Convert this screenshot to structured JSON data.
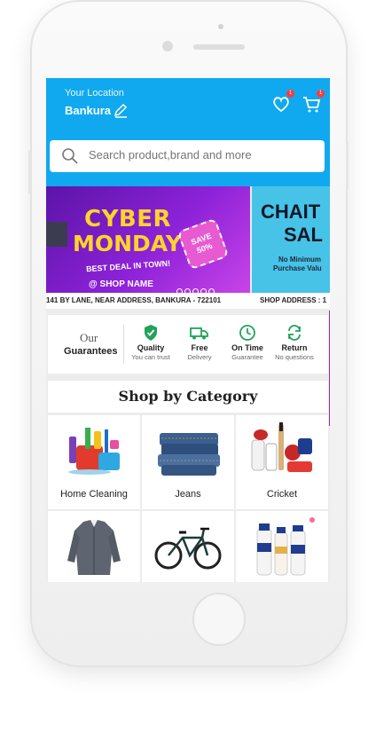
{
  "header": {
    "location_label": "Your Location",
    "location_city": "Bankura",
    "wishlist_badge": "1",
    "cart_badge": "1"
  },
  "search": {
    "placeholder": "Search product,brand and more"
  },
  "banners": {
    "banner1_line1": "CYBER",
    "banner1_line2": "MONDAY",
    "banner1_tagline": "BEST DEAL IN TOWN!",
    "banner1_shop": "@ SHOP NAME",
    "banner1_save": "SAVE 50%",
    "banner2_line1": "CHAIT",
    "banner2_line2": "SAL",
    "banner2_line3": "No Minimum",
    "banner2_line4": "Purchase Valu",
    "address_left": "141 BY LANE, NEAR ADDRESS, BANKURA - 722101",
    "address_right": "SHOP ADDRESS : 1"
  },
  "guarantees": {
    "our": "Our",
    "title": "Guarantees",
    "items": [
      {
        "title": "Quality",
        "sub": "You can trust",
        "icon": "shield-check-icon"
      },
      {
        "title": "Free",
        "sub": "Delivery",
        "icon": "truck-icon"
      },
      {
        "title": "On Time",
        "sub": "Guarantee",
        "icon": "clock-icon"
      },
      {
        "title": "Return",
        "sub": "No questions",
        "icon": "return-icon"
      }
    ]
  },
  "categories": {
    "heading": "Shop by Category",
    "items": [
      {
        "label": "Home Cleaning",
        "icon": "cleaning-supplies-image"
      },
      {
        "label": "Jeans",
        "icon": "jeans-image"
      },
      {
        "label": "Cricket",
        "icon": "cricket-gear-image"
      },
      {
        "label": "",
        "icon": "shirt-image"
      },
      {
        "label": "",
        "icon": "bicycle-image"
      },
      {
        "label": "",
        "icon": "lotion-bottles-image"
      }
    ]
  },
  "colors": {
    "header_blue": "#10a9ef",
    "guarantee_green": "#22a35a",
    "badge_red": "#ff3b3b"
  }
}
